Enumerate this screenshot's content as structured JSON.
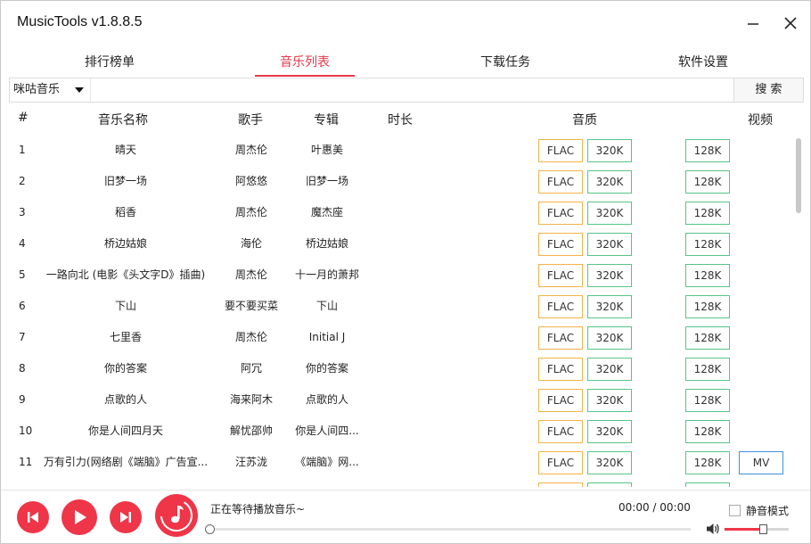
{
  "window": {
    "title": "MusicTools v1.8.8.5"
  },
  "tabs": [
    {
      "label": "排行榜单",
      "active": false
    },
    {
      "label": "音乐列表",
      "active": true
    },
    {
      "label": "下载任务",
      "active": false
    },
    {
      "label": "软件设置",
      "active": false
    }
  ],
  "search": {
    "source": "咪咕音乐",
    "query": "",
    "button_label": "搜 索"
  },
  "table": {
    "headers": {
      "index": "#",
      "name": "音乐名称",
      "singer": "歌手",
      "album": "专辑",
      "duration": "时长",
      "quality": "音质",
      "video": "视频"
    },
    "rows": [
      {
        "index": "1",
        "name": "晴天",
        "singer": "周杰伦",
        "album": "叶惠美",
        "flac": "FLAC",
        "q320": "320K",
        "q128": "128K",
        "mv": ""
      },
      {
        "index": "2",
        "name": "旧梦一场",
        "singer": "阿悠悠",
        "album": "旧梦一场",
        "flac": "FLAC",
        "q320": "320K",
        "q128": "128K",
        "mv": ""
      },
      {
        "index": "3",
        "name": "稻香",
        "singer": "周杰伦",
        "album": "魔杰座",
        "flac": "FLAC",
        "q320": "320K",
        "q128": "128K",
        "mv": ""
      },
      {
        "index": "4",
        "name": "桥边姑娘",
        "singer": "海伦",
        "album": "桥边姑娘",
        "flac": "FLAC",
        "q320": "320K",
        "q128": "128K",
        "mv": ""
      },
      {
        "index": "5",
        "name": "一路向北 (电影《头文字D》插曲)",
        "singer": "周杰伦",
        "album": "十一月的萧邦",
        "flac": "FLAC",
        "q320": "320K",
        "q128": "128K",
        "mv": ""
      },
      {
        "index": "6",
        "name": "下山",
        "singer": "要不要买菜",
        "album": "下山",
        "flac": "FLAC",
        "q320": "320K",
        "q128": "128K",
        "mv": ""
      },
      {
        "index": "7",
        "name": "七里香",
        "singer": "周杰伦",
        "album": "Initial J",
        "flac": "FLAC",
        "q320": "320K",
        "q128": "128K",
        "mv": ""
      },
      {
        "index": "8",
        "name": "你的答案",
        "singer": "阿冗",
        "album": "你的答案",
        "flac": "FLAC",
        "q320": "320K",
        "q128": "128K",
        "mv": ""
      },
      {
        "index": "9",
        "name": "点歌的人",
        "singer": "海来阿木",
        "album": "点歌的人",
        "flac": "FLAC",
        "q320": "320K",
        "q128": "128K",
        "mv": ""
      },
      {
        "index": "10",
        "name": "你是人间四月天",
        "singer": "解忧邵帅",
        "album": "你是人间四...",
        "flac": "FLAC",
        "q320": "320K",
        "q128": "128K",
        "mv": ""
      },
      {
        "index": "11",
        "name": "万有引力(网络剧《端脑》广告宣...",
        "singer": "汪苏泷",
        "album": "《端脑》网...",
        "flac": "FLAC",
        "q320": "320K",
        "q128": "128K",
        "mv": "MV"
      },
      {
        "index": "",
        "name": "",
        "singer": "",
        "album": "",
        "flac": "",
        "q320": "",
        "q128": "",
        "mv": ""
      }
    ]
  },
  "player": {
    "status_text": "正在等待播放音乐~",
    "time_text": "00:00 / 00:00",
    "progress": 0,
    "mute_label": "静音模式",
    "mute_checked": false,
    "volume": 0.6
  },
  "colors": {
    "accent": "#ef3548",
    "flac_border": "#f0b34a",
    "quality_border": "#57c48a",
    "mv_border": "#3f8fe0"
  },
  "icons": {
    "minimize": "minimize-icon",
    "close": "close-icon",
    "dropdown": "caret-down-icon",
    "prev": "skip-previous-icon",
    "play": "play-icon",
    "next": "skip-next-icon",
    "now_playing": "music-note-icon",
    "volume": "speaker-icon"
  }
}
